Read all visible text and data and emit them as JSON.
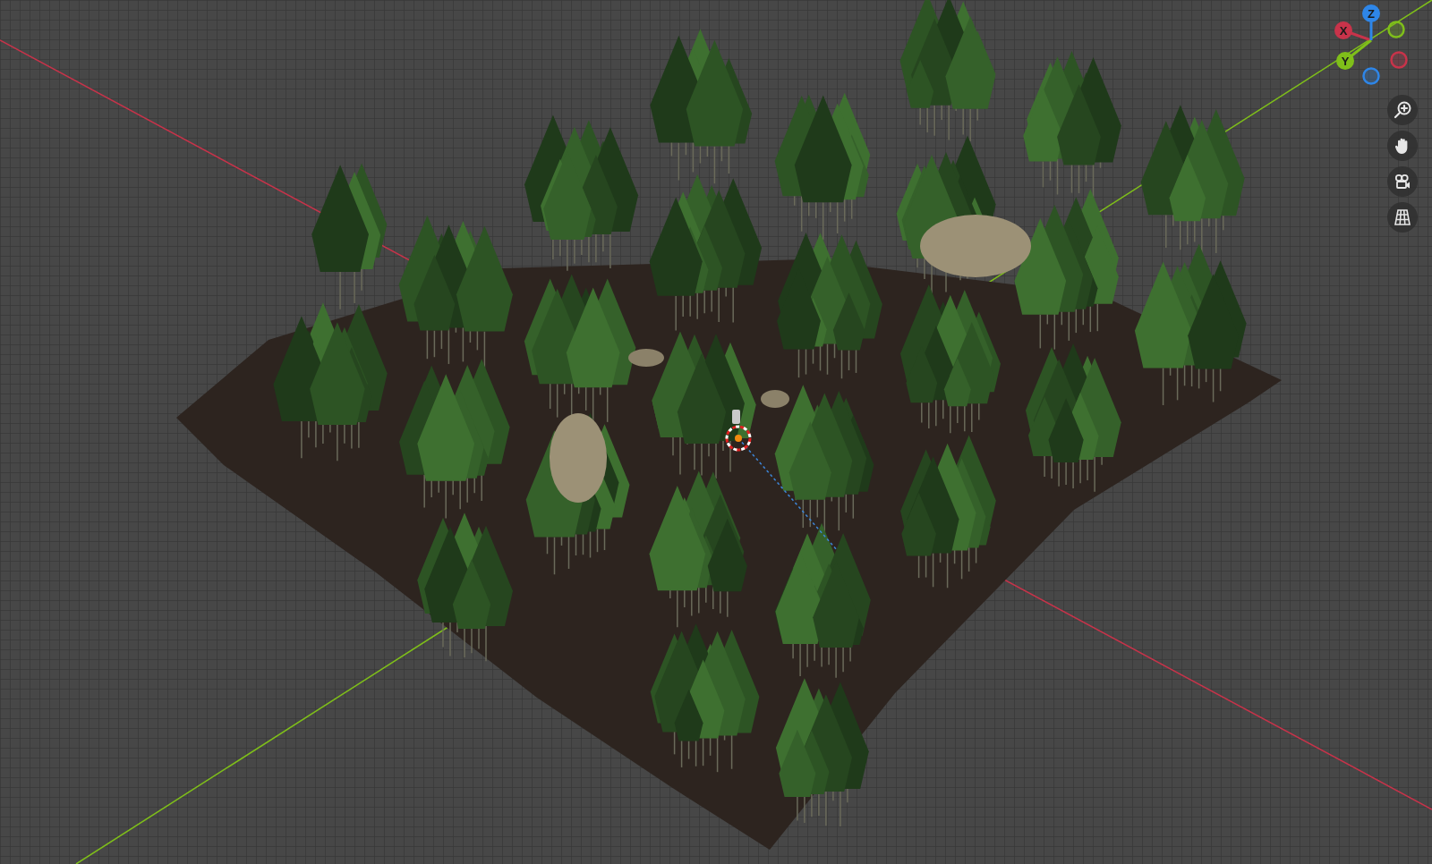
{
  "viewport": {
    "gizmo": {
      "axes": [
        {
          "label": "X",
          "color": "#c8334a"
        },
        {
          "label": "Y",
          "color": "#7fbf1a"
        },
        {
          "label": "Z",
          "color": "#2e86e8"
        }
      ]
    },
    "tools": [
      {
        "kind": "zoom"
      },
      {
        "kind": "pan"
      },
      {
        "kind": "camera"
      },
      {
        "kind": "ortho"
      }
    ]
  }
}
